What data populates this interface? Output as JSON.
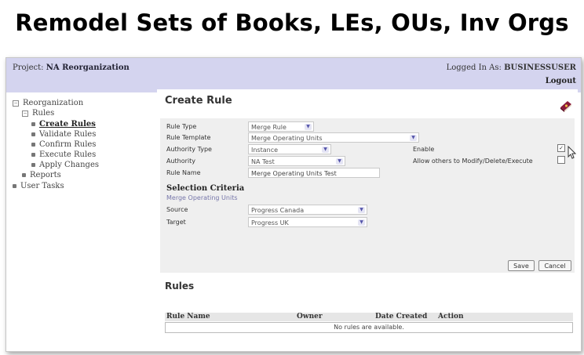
{
  "slide": {
    "title": "Remodel Sets of Books, LEs, OUs, Inv Orgs"
  },
  "header": {
    "project_label": "Project:",
    "project_name": "NA Reorganization",
    "logged_in_label": "Logged In As:",
    "logged_in_user": "BUSINESSUSER",
    "logout": "Logout"
  },
  "nav": {
    "reorganization": "Reorganization",
    "rules": "Rules",
    "items": [
      "Create Rules",
      "Validate Rules",
      "Confirm Rules",
      "Execute Rules",
      "Apply Changes"
    ],
    "reports": "Reports",
    "user_tasks": "User Tasks"
  },
  "form": {
    "title": "Create Rule",
    "rule_type_label": "Rule Type",
    "rule_type_value": "Merge Rule",
    "rule_template_label": "Rule Template",
    "rule_template_value": "Merge Operating Units",
    "authority_type_label": "Authority Type",
    "authority_type_value": "Instance",
    "authority_label": "Authority",
    "authority_value": "NA Test",
    "rule_name_label": "Rule Name",
    "rule_name_value": "Merge Operating Units Test",
    "enable_label": "Enable",
    "enable_checked": true,
    "allow_label": "Allow others to Modify/Delete/Execute",
    "allow_checked": false,
    "selection_criteria": "Selection Criteria",
    "selection_sub": "Merge Operating Units",
    "source_label": "Source",
    "source_value": "Progress Canada",
    "target_label": "Target",
    "target_value": "Progress UK",
    "save": "Save",
    "cancel": "Cancel"
  },
  "rules": {
    "title": "Rules",
    "columns": [
      "Rule Name",
      "Owner",
      "Date Created",
      "Action"
    ],
    "empty": "No rules are available."
  },
  "icons": {
    "tree_collapse": "minus-box-icon",
    "tree_bullet": "bullet-icon",
    "dropdown": "chevron-down-icon",
    "help_book": "help-book-icon",
    "cursor": "mouse-pointer-icon"
  }
}
